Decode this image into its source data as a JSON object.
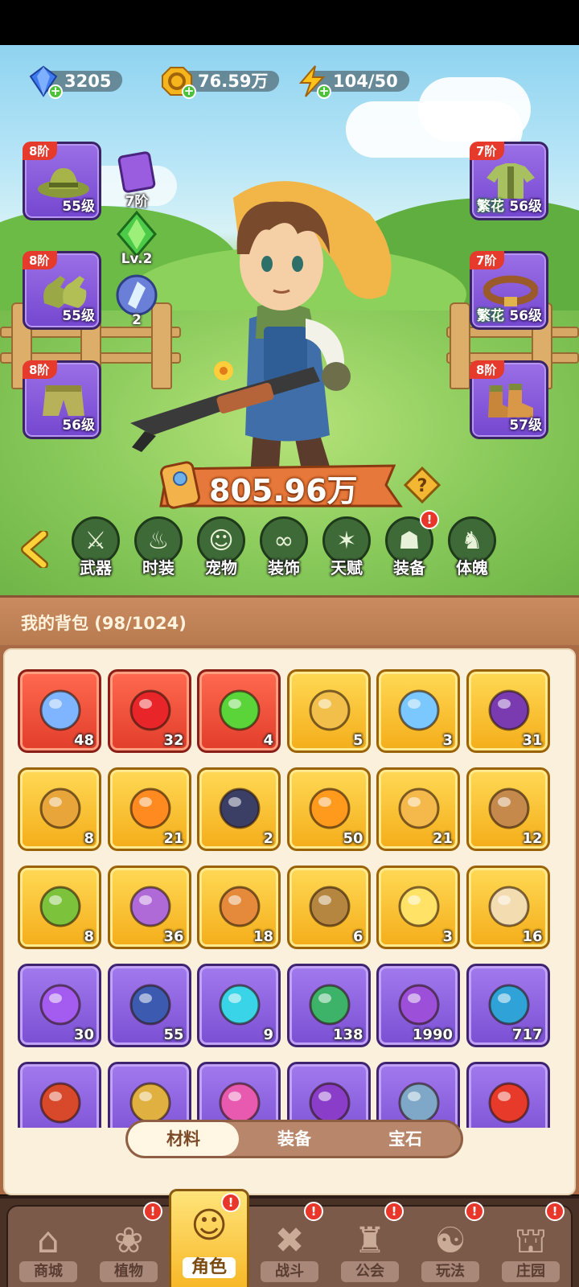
{
  "currencies": [
    {
      "name": "diamond",
      "icon": "diamond-icon",
      "value": "3205"
    },
    {
      "name": "gold",
      "icon": "gold-coin-icon",
      "value": "76.59万"
    },
    {
      "name": "energy",
      "icon": "lightning-icon",
      "value": "104/50"
    }
  ],
  "equipment_left": [
    {
      "slot": "hat",
      "icon": "hat-icon",
      "tier": "8阶",
      "level": "55级"
    },
    {
      "slot": "gloves",
      "icon": "gloves-icon",
      "tier": "8阶",
      "level": "55级"
    },
    {
      "slot": "pants",
      "icon": "pants-icon",
      "tier": "8阶",
      "level": "56级"
    }
  ],
  "equipment_right": [
    {
      "slot": "clothes",
      "icon": "shirt-icon",
      "tier": "7阶",
      "tag": "繁花",
      "level": "56级"
    },
    {
      "slot": "belt",
      "icon": "belt-icon",
      "tier": "7阶",
      "tag": "繁花",
      "level": "56级"
    },
    {
      "slot": "boots",
      "icon": "boots-icon",
      "tier": "8阶",
      "level": "57级"
    }
  ],
  "mini_stats": [
    {
      "icon": "purple-card-icon",
      "value": "7阶"
    },
    {
      "icon": "green-gem-icon",
      "value": "Lv.2"
    },
    {
      "icon": "crystal-orb-icon",
      "value": "2"
    }
  ],
  "power": "805.96万",
  "tabs": [
    {
      "label": "武器",
      "icon": "weapon-icon",
      "badge": false
    },
    {
      "label": "时装",
      "icon": "costume-icon",
      "badge": false
    },
    {
      "label": "宠物",
      "icon": "pet-icon",
      "badge": false
    },
    {
      "label": "装饰",
      "icon": "mask-icon",
      "badge": false
    },
    {
      "label": "天赋",
      "icon": "talent-icon",
      "badge": false
    },
    {
      "label": "装备",
      "icon": "equipment-icon",
      "badge": true,
      "badge_text": "!"
    },
    {
      "label": "体魄",
      "icon": "spirit-icon",
      "badge": false
    }
  ],
  "bag": {
    "title": "我的背包 (98/1024)",
    "items": [
      {
        "rarity": "red",
        "icon": "star-crystal-icon",
        "count": "48",
        "color": "#7fb4ff"
      },
      {
        "rarity": "red",
        "icon": "red-potion-icon",
        "count": "32",
        "color": "#e8262a"
      },
      {
        "rarity": "red",
        "icon": "green-canister-icon",
        "count": "4",
        "color": "#5bd43a"
      },
      {
        "rarity": "gold",
        "icon": "gold-bottle-icon",
        "count": "5",
        "color": "#f2c04a"
      },
      {
        "rarity": "gold",
        "icon": "water-drop-icon",
        "count": "3",
        "color": "#7ac8ff"
      },
      {
        "rarity": "gold",
        "icon": "skull-card-icon",
        "count": "31",
        "color": "#7a3bb0"
      },
      {
        "rarity": "gold",
        "icon": "key-icon",
        "count": "8",
        "color": "#e7a53a"
      },
      {
        "rarity": "gold",
        "icon": "fire-prism-icon",
        "count": "21",
        "color": "#ff8a1f"
      },
      {
        "rarity": "gold",
        "icon": "rune-stone-icon",
        "count": "2",
        "color": "#3b3f66"
      },
      {
        "rarity": "gold",
        "icon": "orange-potion-icon",
        "count": "50",
        "color": "#ff9a1c"
      },
      {
        "rarity": "gold",
        "icon": "gold-pile-icon",
        "count": "21",
        "color": "#f5b94b"
      },
      {
        "rarity": "gold",
        "icon": "flower-pot-icon",
        "count": "12",
        "color": "#c58a4b"
      },
      {
        "rarity": "gold",
        "icon": "sprayer-icon",
        "count": "8",
        "color": "#7cc23a"
      },
      {
        "rarity": "gold",
        "icon": "spell-book-icon",
        "count": "36",
        "color": "#b06ad8"
      },
      {
        "rarity": "gold",
        "icon": "tin-can-icon",
        "count": "18",
        "color": "#e48a3a"
      },
      {
        "rarity": "gold",
        "icon": "owl-icon",
        "count": "6",
        "color": "#b5863f"
      },
      {
        "rarity": "gold",
        "icon": "glowing-flower-icon",
        "count": "3",
        "color": "#ffe266"
      },
      {
        "rarity": "gold",
        "icon": "knot-emblem-icon",
        "count": "16",
        "color": "#f3dcb0"
      },
      {
        "rarity": "purple",
        "icon": "perfume-bottle-icon",
        "count": "30",
        "color": "#a45cf0"
      },
      {
        "rarity": "purple",
        "icon": "lightning-badge-icon",
        "count": "55",
        "color": "#3c5bb0"
      },
      {
        "rarity": "purple",
        "icon": "cyan-leaf-icon",
        "count": "9",
        "color": "#3ad4e8"
      },
      {
        "rarity": "purple",
        "icon": "scroll-green-icon",
        "count": "138",
        "color": "#3db36a"
      },
      {
        "rarity": "purple",
        "icon": "scroll-purple-icon",
        "count": "1990",
        "color": "#9c4fd8"
      },
      {
        "rarity": "purple",
        "icon": "scroll-blue-icon",
        "count": "717",
        "color": "#2fa3d8"
      },
      {
        "rarity": "purple",
        "icon": "red-pouch-icon",
        "count": "",
        "color": "#d8482a"
      },
      {
        "rarity": "purple",
        "icon": "gold-tube-icon",
        "count": "",
        "color": "#e0b040"
      },
      {
        "rarity": "purple",
        "icon": "pink-potion-icon",
        "count": "",
        "color": "#e85ab0"
      },
      {
        "rarity": "purple",
        "icon": "purple-bulb-icon",
        "count": "",
        "color": "#8a3dc8"
      },
      {
        "rarity": "purple",
        "icon": "teapot-icon",
        "count": "",
        "color": "#7fa8c8"
      },
      {
        "rarity": "purple",
        "icon": "fruit-basket-icon",
        "count": "",
        "color": "#e83a2a"
      }
    ],
    "segments": [
      {
        "label": "材料",
        "active": true
      },
      {
        "label": "装备",
        "active": false
      },
      {
        "label": "宝石",
        "active": false
      }
    ]
  },
  "nav": [
    {
      "label": "商城",
      "icon": "shop-icon",
      "badge": false,
      "active": false
    },
    {
      "label": "植物",
      "icon": "plant-icon",
      "badge": true,
      "active": false
    },
    {
      "label": "角色",
      "icon": "character-icon",
      "badge": true,
      "active": true
    },
    {
      "label": "战斗",
      "icon": "battle-icon",
      "badge": true,
      "active": false
    },
    {
      "label": "公会",
      "icon": "guild-icon",
      "badge": true,
      "active": false
    },
    {
      "label": "玩法",
      "icon": "gameplay-icon",
      "badge": true,
      "active": false
    },
    {
      "label": "庄园",
      "icon": "manor-icon",
      "badge": true,
      "active": false
    }
  ],
  "badge_text": "!"
}
